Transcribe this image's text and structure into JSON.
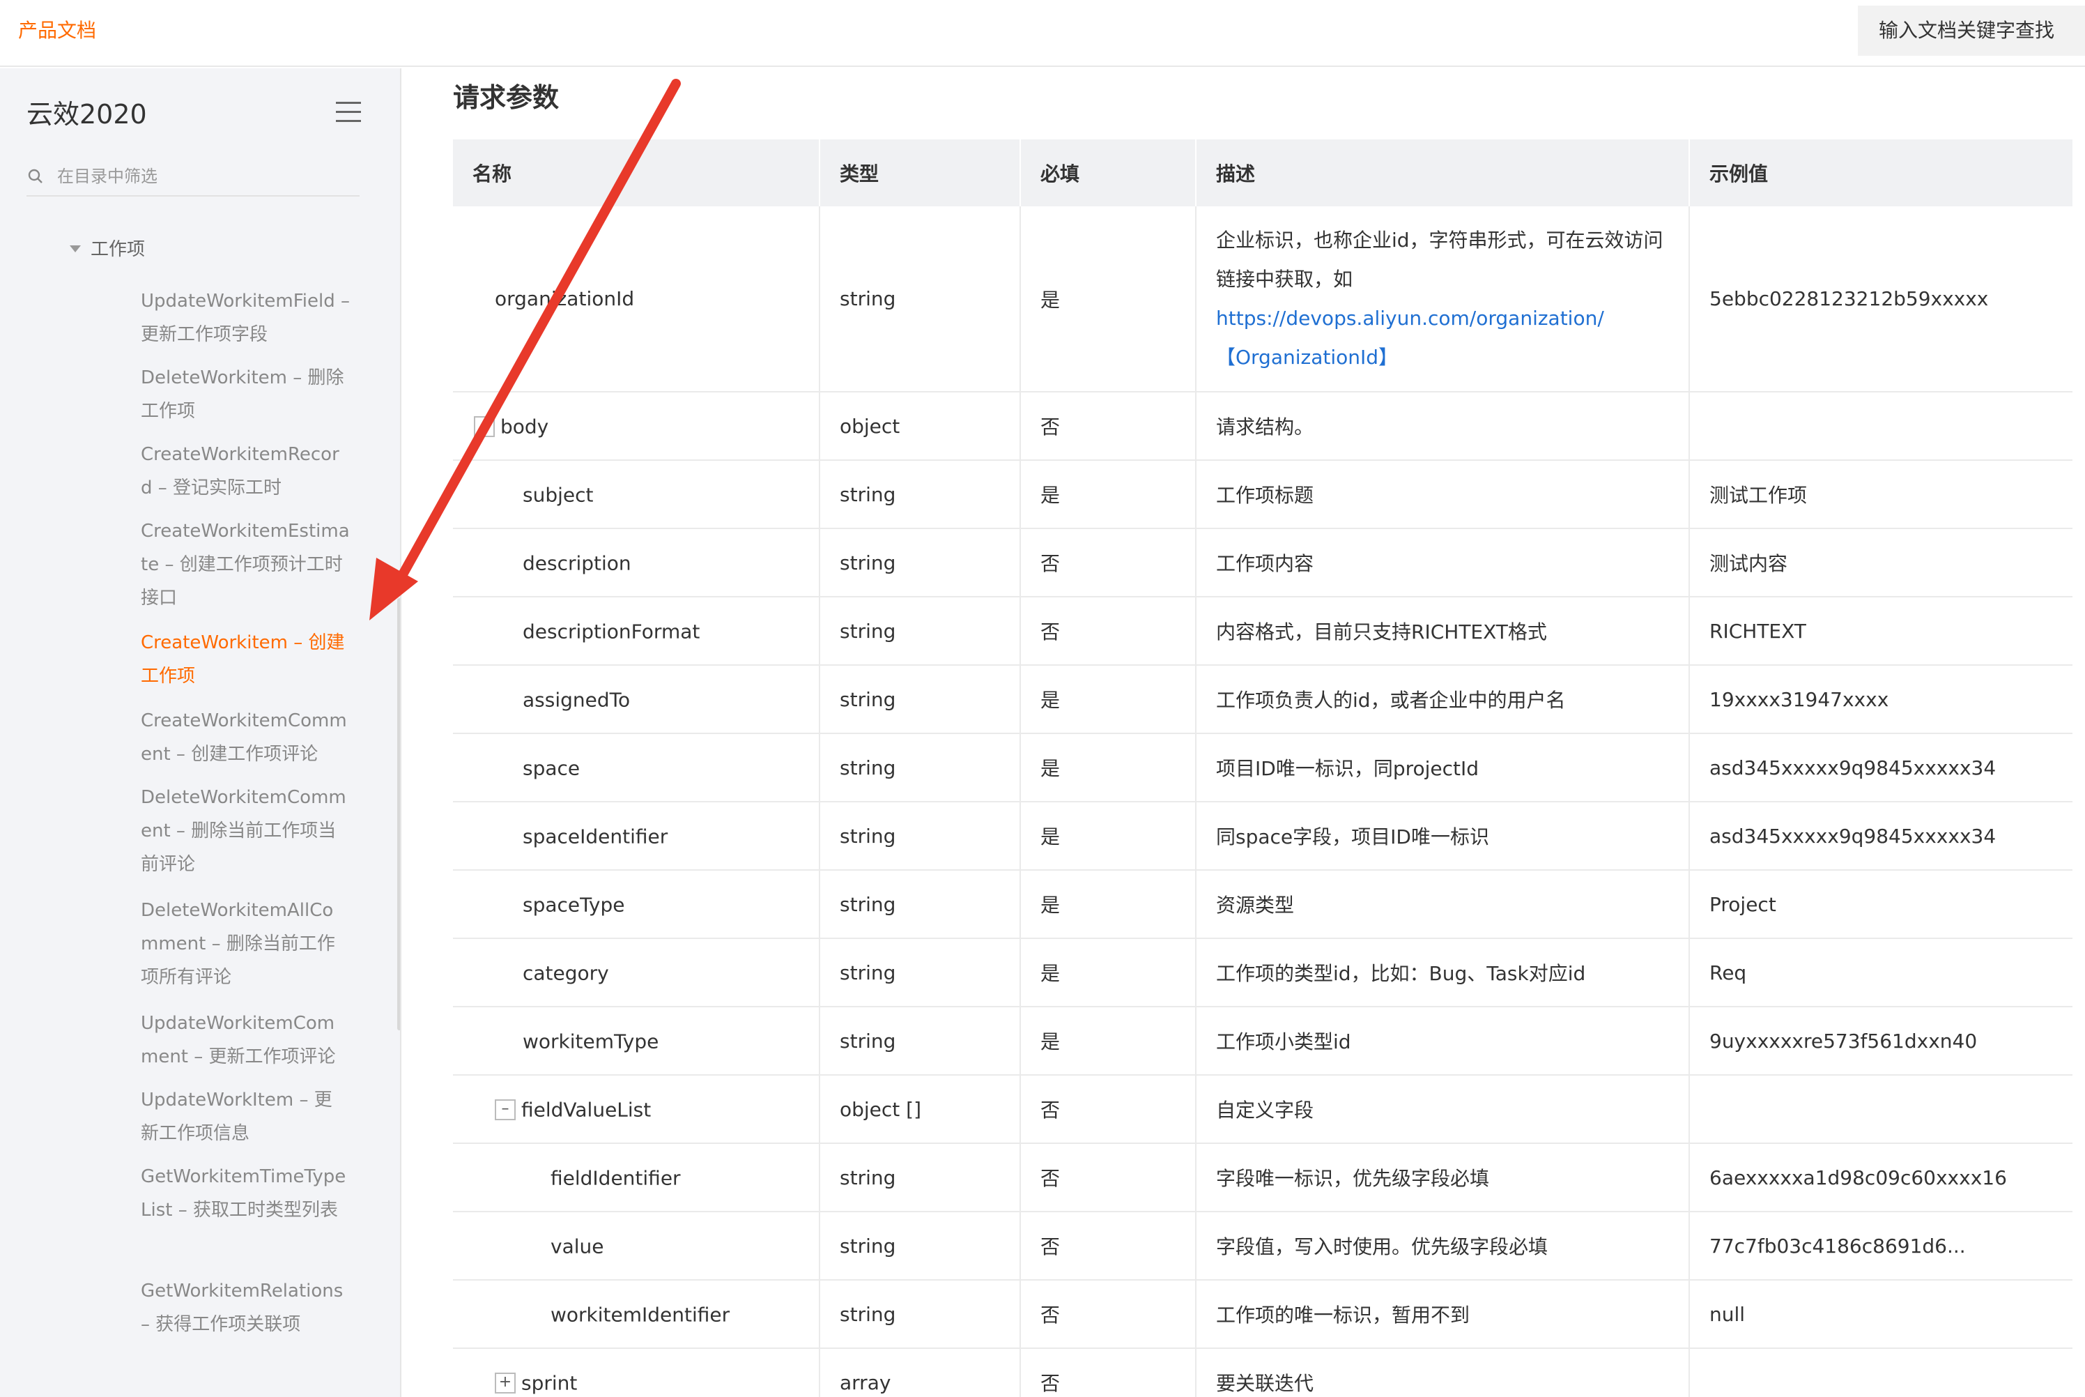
{
  "header": {
    "brand": "产品文档",
    "search_label": "输入文档关键字查找"
  },
  "sidebar": {
    "title": "云效2020",
    "filter_placeholder": "在目录中筛选",
    "parent": "工作项",
    "items": [
      {
        "label": "UpdateWorkitemField – 更新工作项字段"
      },
      {
        "label": "DeleteWorkitem – 删除工作项"
      },
      {
        "label": "CreateWorkitemRecord – 登记实际工时"
      },
      {
        "label": "CreateWorkitemEstimate – 创建工作项预计工时接口"
      },
      {
        "label": "CreateWorkitem – 创建工作项"
      },
      {
        "label": "CreateWorkitemComment – 创建工作项评论"
      },
      {
        "label": "DeleteWorkitemComment – 删除当前工作项当前评论"
      },
      {
        "label": "DeleteWorkitemAllComment – 删除当前工作项所有评论"
      },
      {
        "label": "UpdateWorkitemComment – 更新工作项评论"
      },
      {
        "label": "UpdateWorkItem – 更新工作项信息"
      },
      {
        "label": "GetWorkitemTimeTypeList – 获取工时类型列表"
      },
      {
        "label": "GetWorkitemRelations – 获得工作项关联项"
      }
    ]
  },
  "main": {
    "section_title": "请求参数",
    "columns": [
      "名称",
      "类型",
      "必填",
      "描述",
      "示例值"
    ],
    "org_row": {
      "name": "organizationId",
      "type": "string",
      "required": "是",
      "desc_line1": "企业标识，也称企业id，字符串形式，可在云效访问链接中获取，如",
      "desc_link": "https://devops.aliyun.com/organization/【OrganizationId】",
      "example": "5ebbc0228123212b59xxxxx"
    },
    "rows": [
      {
        "name": "body",
        "type": "object",
        "required": "否",
        "desc": "请求结构。",
        "example": "",
        "expander": "–"
      },
      {
        "name": "subject",
        "type": "string",
        "required": "是",
        "desc": "工作项标题",
        "example": "测试工作项"
      },
      {
        "name": "description",
        "type": "string",
        "required": "否",
        "desc": "工作项内容",
        "example": "测试内容"
      },
      {
        "name": "descriptionFormat",
        "type": "string",
        "required": "否",
        "desc": "内容格式，目前只支持RICHTEXT格式",
        "example": "RICHTEXT"
      },
      {
        "name": "assignedTo",
        "type": "string",
        "required": "是",
        "desc": "工作项负责人的id，或者企业中的用户名",
        "example": "19xxxx31947xxxx"
      },
      {
        "name": "space",
        "type": "string",
        "required": "是",
        "desc": "项目ID唯一标识，同projectId",
        "example": "asd345xxxxx9q9845xxxxx34"
      },
      {
        "name": "spaceIdentifier",
        "type": "string",
        "required": "是",
        "desc": "同space字段，项目ID唯一标识",
        "example": "asd345xxxxx9q9845xxxxx34"
      },
      {
        "name": "spaceType",
        "type": "string",
        "required": "是",
        "desc": "资源类型",
        "example": "Project"
      },
      {
        "name": "category",
        "type": "string",
        "required": "是",
        "desc": "工作项的类型id，比如：Bug、Task对应id",
        "example": "Req"
      },
      {
        "name": "workitemType",
        "type": "string",
        "required": "是",
        "desc": "工作项小类型id",
        "example": "9uyxxxxxre573f561dxxn40"
      },
      {
        "name": "fieldValueList",
        "type": "object []",
        "required": "否",
        "desc": "自定义字段",
        "example": "",
        "expander": "–"
      },
      {
        "name": "fieldIdentifier",
        "type": "string",
        "required": "否",
        "desc": "字段唯一标识，优先级字段必填",
        "example": "6aexxxxxa1d98c09c60xxxx16"
      },
      {
        "name": "value",
        "type": "string",
        "required": "否",
        "desc": "字段值，写入时使用。优先级字段必填",
        "example": "77c7fb03c4186c8691d6..."
      },
      {
        "name": "workitemIdentifier",
        "type": "string",
        "required": "否",
        "desc": "工作项的唯一标识，暂用不到",
        "example": "null"
      },
      {
        "name": "sprint",
        "type": "array",
        "required": "否",
        "desc": "要关联迭代",
        "example": "",
        "expander": "+"
      }
    ]
  },
  "colors": {
    "accent": "#ff6a00",
    "link": "#1f6fd2",
    "arrow": "#e8392a"
  }
}
